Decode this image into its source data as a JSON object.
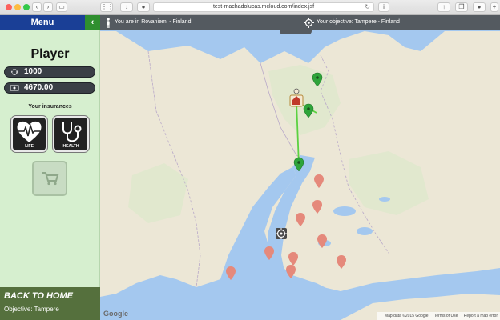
{
  "browser": {
    "url": "test-machadolucas.mcloud.com/index.jsf"
  },
  "sidebar": {
    "menu_title": "Menu",
    "menu_toggle_glyph": "‹",
    "player_title": "Player",
    "energy_value": "1000",
    "money_value": "4670.00",
    "insurances_title": "Your insurances",
    "insurances": [
      {
        "label": "LIFE",
        "icon": "heart-icon"
      },
      {
        "label": "HEALTH",
        "icon": "stethoscope-icon"
      }
    ],
    "cart_icon": "cart-icon",
    "back_label": "BACK TO HOME",
    "objective_label": "Objective: Tampere"
  },
  "map": {
    "location_text": "You are in Rovaniemi - Finland",
    "objective_text": "Your objective: Tampere - Finland",
    "google_label": "Google",
    "footer": {
      "map_data": "Map data ©2015 Google",
      "terms": "Terms of Use",
      "report": "Report a map error"
    }
  },
  "colors": {
    "menu_bar": "#1a3f96",
    "toggle": "#2f8f2f",
    "sidebar_bg": "#d6efcf",
    "back_panel": "#55703d",
    "water": "#a4c8ef",
    "land": "#ece7d6",
    "route": "#5bd141",
    "pin_green": "#2ea43a",
    "pin_red": "#e5897b"
  }
}
